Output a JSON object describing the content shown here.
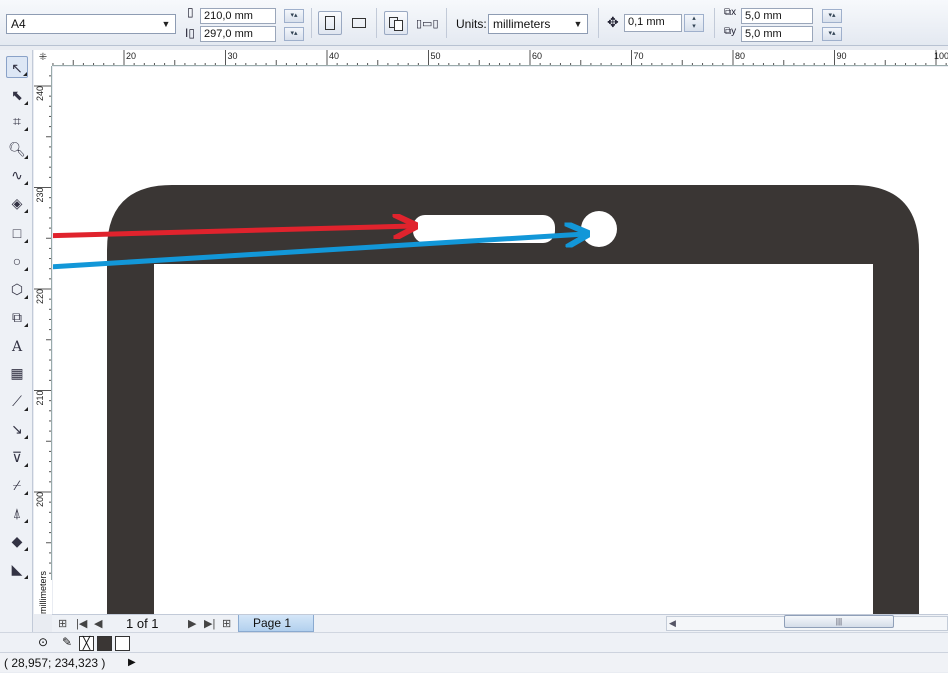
{
  "property_bar": {
    "paper_size": "A4",
    "width": "210,0 mm",
    "height": "297,0 mm",
    "units_label": "Units:",
    "units_value": "millimeters",
    "nudge": "0,1 mm",
    "dup_x": "5,0 mm",
    "dup_y": "5,0 mm"
  },
  "rulers": {
    "top_labels": [
      "20",
      "30",
      "40",
      "50",
      "60",
      "70",
      "80",
      "90",
      "100"
    ],
    "left_labels": [
      "240",
      "230",
      "220",
      "210",
      "200"
    ],
    "units": "millimeters"
  },
  "toolbox": [
    "pick-tool",
    "shape-tool",
    "crop-tool",
    "zoom-tool",
    "freehand-tool",
    "smart-fill-tool",
    "rectangle-tool",
    "ellipse-tool",
    "polygon-tool",
    "basic-shapes-tool",
    "text-tool",
    "table-tool",
    "dimension-tool",
    "connector-tool",
    "blend-tool",
    "eyedropper-tool",
    "outline-pen-tool",
    "fill-tool",
    "interactive-fill-tool"
  ],
  "page_nav": {
    "page_count": "1 of 1",
    "page_tab": "Page 1"
  },
  "colors": {
    "shape": "#3a3634",
    "red_arrow": "#e0232d",
    "blue_arrow": "#1297d8"
  },
  "status": {
    "coords": "( 28,957; 234,323 )"
  }
}
